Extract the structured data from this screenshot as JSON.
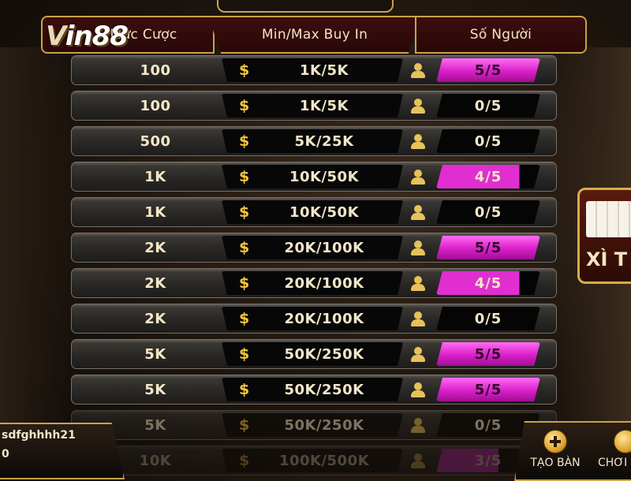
{
  "logo": {
    "v": "V",
    "rest": "in",
    "num": "88"
  },
  "header": {
    "col_stake": "Mức Cược",
    "col_buyin": "Min/Max Buy In",
    "col_players": "Số Người"
  },
  "currency_symbol": "$",
  "rows": [
    {
      "stake": "100",
      "buyin": "1K/5K",
      "players": "5/5",
      "fill": 1.0
    },
    {
      "stake": "100",
      "buyin": "1K/5K",
      "players": "0/5",
      "fill": 0.0
    },
    {
      "stake": "500",
      "buyin": "5K/25K",
      "players": "0/5",
      "fill": 0.0
    },
    {
      "stake": "1K",
      "buyin": "10K/50K",
      "players": "4/5",
      "fill": 0.8
    },
    {
      "stake": "1K",
      "buyin": "10K/50K",
      "players": "0/5",
      "fill": 0.0
    },
    {
      "stake": "2K",
      "buyin": "20K/100K",
      "players": "5/5",
      "fill": 1.0
    },
    {
      "stake": "2K",
      "buyin": "20K/100K",
      "players": "4/5",
      "fill": 0.8
    },
    {
      "stake": "2K",
      "buyin": "20K/100K",
      "players": "0/5",
      "fill": 0.0
    },
    {
      "stake": "5K",
      "buyin": "50K/250K",
      "players": "5/5",
      "fill": 1.0
    },
    {
      "stake": "5K",
      "buyin": "50K/250K",
      "players": "5/5",
      "fill": 1.0
    },
    {
      "stake": "5K",
      "buyin": "50K/250K",
      "players": "0/5",
      "fill": 0.0
    },
    {
      "stake": "10K",
      "buyin": "100K/500K",
      "players": "3/5",
      "fill": 0.6
    }
  ],
  "side_card": {
    "text": "XÌ T"
  },
  "user": {
    "name": "sdfghhhh21",
    "balance": "0"
  },
  "buttons": {
    "create": "TẠO BÀN",
    "play": "CHƠI"
  },
  "colors": {
    "gold": "#c9a24a",
    "magenta": "#e12ed0",
    "header_red": "#3c0d0d"
  }
}
